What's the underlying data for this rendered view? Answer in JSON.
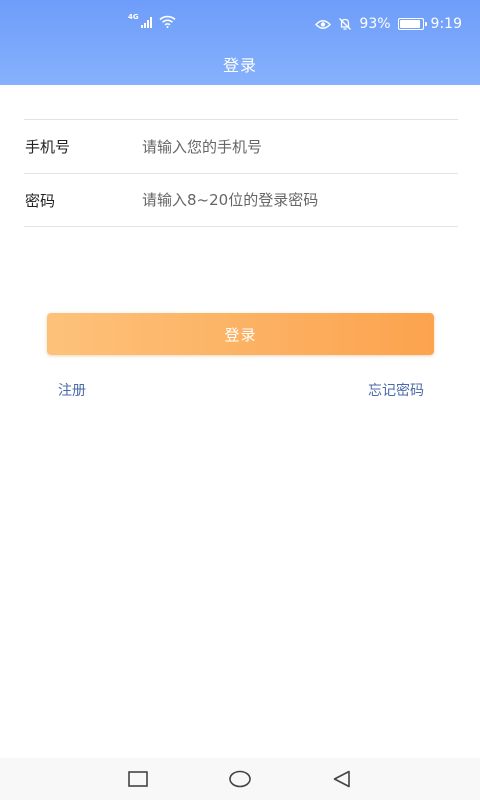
{
  "status_bar": {
    "network_type": "4G",
    "battery_percent": "93%",
    "battery_level": 0.93,
    "time": "9:19",
    "icons": [
      "signal-icon",
      "wifi-icon",
      "eye-icon",
      "alarm-off-icon",
      "battery-icon"
    ]
  },
  "header": {
    "title": "登录"
  },
  "form": {
    "phone_label": "手机号",
    "phone_placeholder": "请输入您的手机号",
    "password_label": "密码",
    "password_placeholder": "请输入8~20位的登录密码"
  },
  "actions": {
    "login_label": "登录",
    "register_label": "注册",
    "forgot_label": "忘记密码"
  },
  "colors": {
    "header_gradient": [
      "#6e9dfa",
      "#86b1fc"
    ],
    "button_gradient": [
      "#fdc27a",
      "#fca34e"
    ],
    "link": "#4a6aa8"
  },
  "nav_bar": {
    "icons": [
      "recent-apps-icon",
      "home-icon",
      "back-icon"
    ]
  }
}
